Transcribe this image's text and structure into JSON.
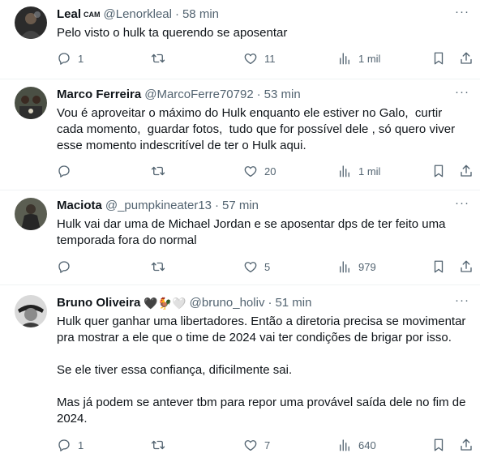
{
  "tweets": [
    {
      "name": "Leal",
      "badge": "CAM",
      "handle": "@Lenorkleal",
      "sep": "·",
      "time": "58 min",
      "text": "Pelo visto o hulk ta querendo se aposentar",
      "replies": "1",
      "retweets": "",
      "likes": "11",
      "views": "1 mil"
    },
    {
      "name": "Marco Ferreira",
      "handle": "@MarcoFerre70792",
      "sep": "·",
      "time": "53 min",
      "text": "Vou é aproveitar o máximo do Hulk enquanto ele estiver no Galo,  curtir cada momento,  guardar fotos,  tudo que for possível dele , só quero viver esse momento indescritível de ter o Hulk aqui.",
      "replies": "",
      "retweets": "",
      "likes": "20",
      "views": "1 mil"
    },
    {
      "name": "Maciota",
      "handle": "@_pumpkineater13",
      "sep": "·",
      "time": "57 min",
      "text": "Hulk vai dar uma de Michael Jordan e se aposentar dps de ter feito uma temporada fora do normal",
      "replies": "",
      "retweets": "",
      "likes": "5",
      "views": "979"
    },
    {
      "name": "Bruno Oliveira",
      "emojis": "🖤🐓🤍",
      "handle": "@bruno_holiv",
      "sep": "·",
      "time": "51 min",
      "text": "Hulk quer ganhar uma libertadores. Então a diretoria precisa se movimentar pra mostrar a ele que o time de 2024 vai ter condições de brigar por isso.\n\nSe ele tiver essa confiança, dificilmente sai.\n\nMas já podem se antever tbm para repor uma provável saída dele no fim de 2024.",
      "replies": "1",
      "retweets": "",
      "likes": "7",
      "views": "640"
    }
  ],
  "more_label": "···",
  "colors": {
    "text": "#0f1419",
    "muted": "#536471",
    "divider": "#eff3f4"
  }
}
